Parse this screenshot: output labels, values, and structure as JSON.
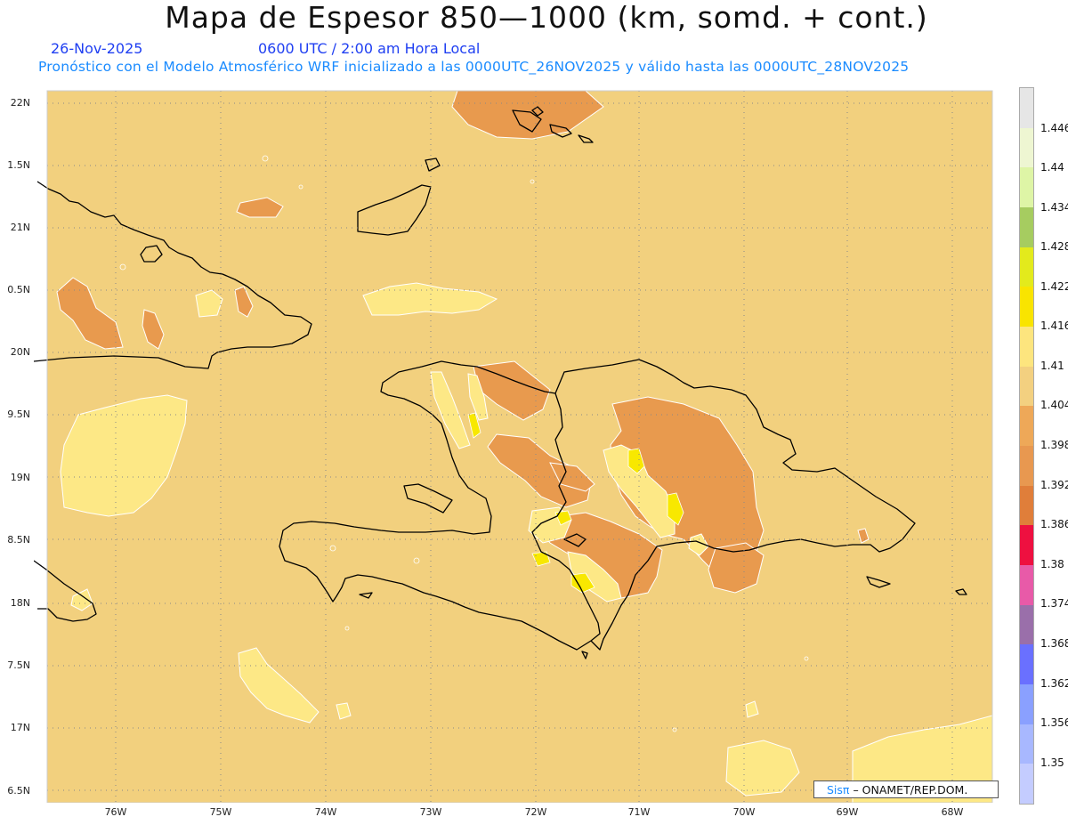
{
  "title": "Mapa de Espesor 850—1000 (km, somd. + cont.)",
  "date": "26-Nov-2025",
  "valid_time": "0600 UTC / 2:00 am Hora Local",
  "forecast_note": "Pronóstico con el Modelo Atmosférico WRF inicializado a las 0000UTC_26NOV2025 y válido hasta las  0000UTC_28NOV2025",
  "lat_labels": [
    "22N",
    "1.5N",
    "21N",
    "0.5N",
    "20N",
    "9.5N",
    "19N",
    "8.5N",
    "18N",
    "7.5N",
    "17N",
    "6.5N"
  ],
  "lon_labels": [
    "76W",
    "75W",
    "74W",
    "73W",
    "72W",
    "71W",
    "70W",
    "69W",
    "68W"
  ],
  "colorbar": {
    "labels": [
      "1.446",
      "1.44",
      "1.434",
      "1.428",
      "1.422",
      "1.416",
      "1.41",
      "1.404",
      "1.398",
      "1.392",
      "1.386",
      "1.38",
      "1.374",
      "1.368",
      "1.362",
      "1.356",
      "1.35"
    ],
    "colors": [
      "#c4ccff",
      "#a8b8ff",
      "#8aa0ff",
      "#6a70ff",
      "#9a6faa",
      "#e85aa8",
      "#ee1040",
      "#e07e3a",
      "#e89850",
      "#eea858",
      "#f3d080",
      "#fde57e",
      "#f9e400",
      "#e3ea1c",
      "#a6cc60",
      "#def5a6",
      "#eef6d2",
      "#e6e6e6"
    ]
  },
  "map_colors": {
    "base": "#f2d07e",
    "low": "#e89a4e",
    "high": "#fde886",
    "highest": "#f8e800",
    "coast": "#000000"
  },
  "credit": {
    "brand": "Sisπ",
    "text": "– ONAMET/REP.DOM."
  }
}
